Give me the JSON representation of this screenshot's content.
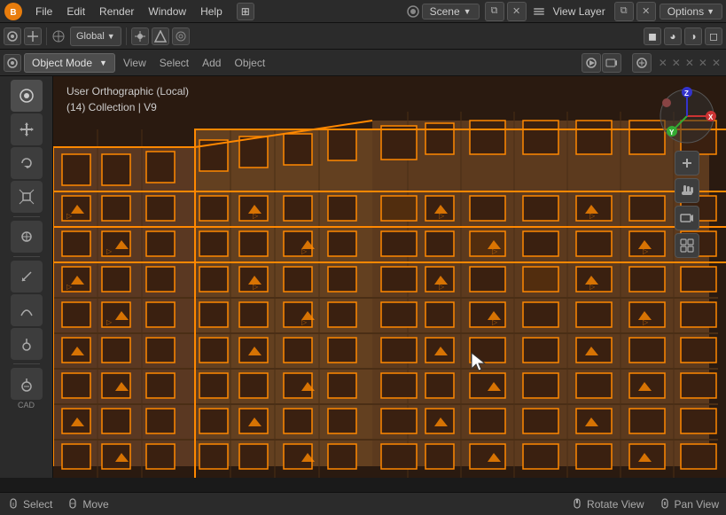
{
  "app": {
    "title": "Blender"
  },
  "top_menu": {
    "items": [
      "File",
      "Edit",
      "Render",
      "Window",
      "Help"
    ],
    "scene_label": "Scene",
    "view_layer_label": "View Layer",
    "options_label": "Options"
  },
  "second_toolbar": {
    "transform_label": "Global",
    "snap_btn": "⊕"
  },
  "mode_bar": {
    "object_mode_label": "Object Mode",
    "view_label": "View",
    "select_label": "Select",
    "add_label": "Add",
    "object_label": "Object"
  },
  "viewport": {
    "view_type": "User Orthographic (Local)",
    "collection": "(14) Collection | V9"
  },
  "left_sidebar": {
    "tools": [
      "⊕",
      "↔",
      "↺",
      "⊞",
      "●",
      "✎",
      "∿",
      "⌀"
    ],
    "cad_label": "CAD"
  },
  "right_gizmo": {
    "axes": [
      "X",
      "Y",
      "Z"
    ],
    "buttons": [
      "✛",
      "✋",
      "🎥",
      "▦"
    ]
  },
  "bottom_bar": {
    "select_label": "Select",
    "move_label": "Move",
    "rotate_label": "Rotate View",
    "pan_label": "Pan View"
  },
  "colors": {
    "orange_outline": "#ff8800",
    "building_dark": "#5a3a2a",
    "building_medium": "#7a5a3a",
    "background": "#1a1a1a",
    "toolbar_bg": "#2b2b2b",
    "accent_blue": "#4488cc"
  }
}
